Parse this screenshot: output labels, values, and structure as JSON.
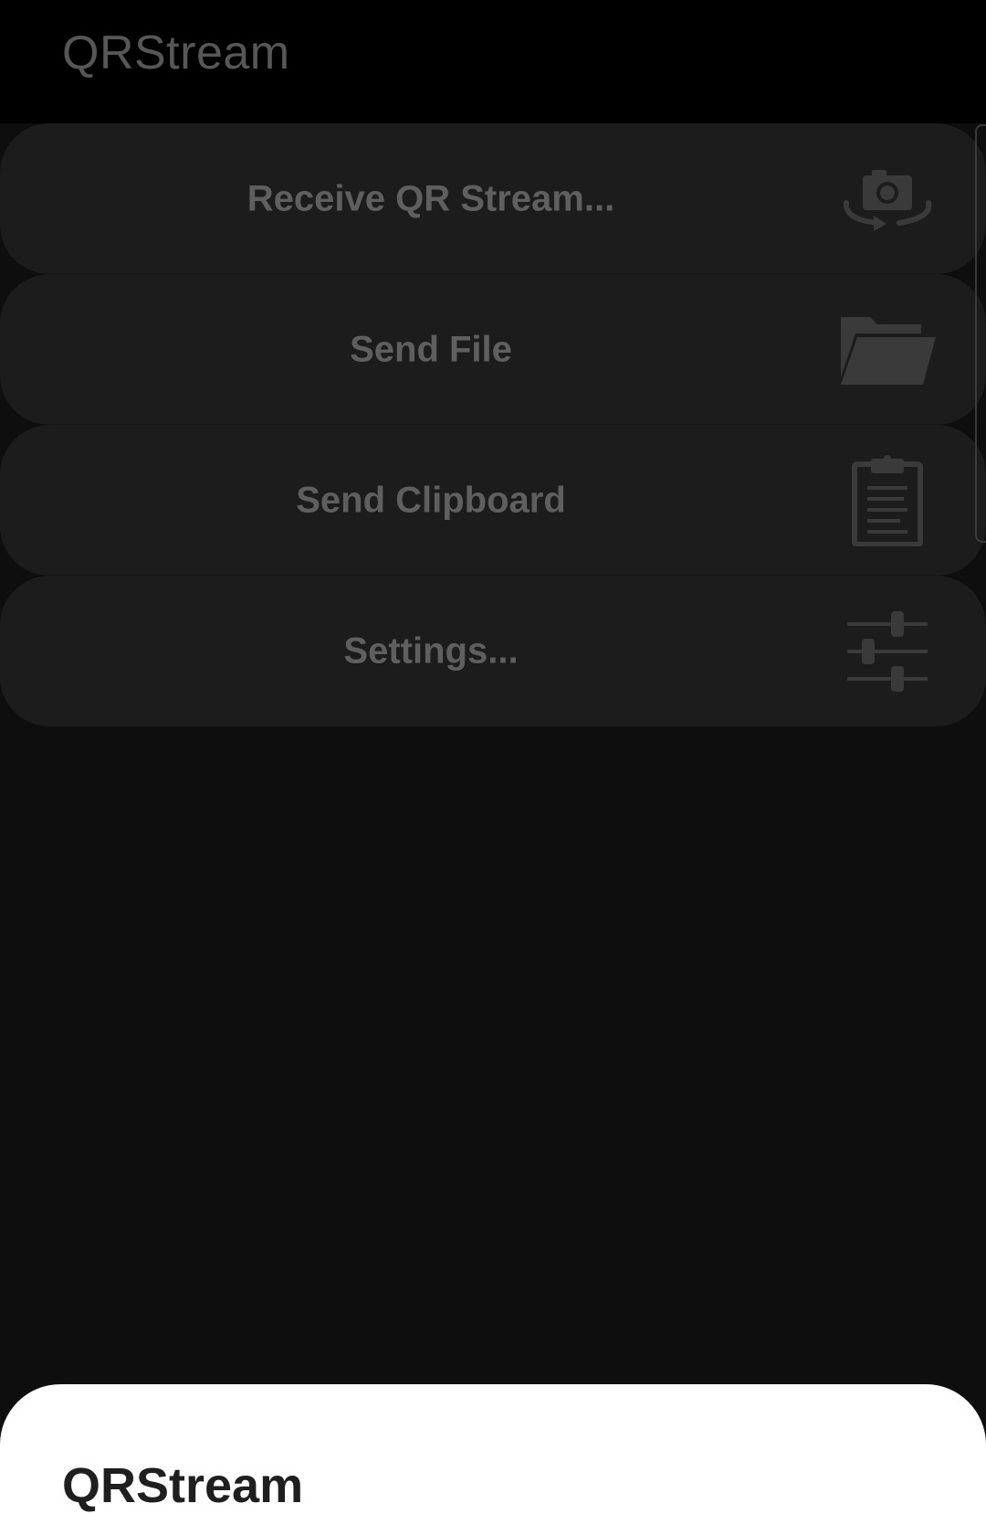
{
  "app_bar": {
    "title": "QRStream"
  },
  "menu": {
    "items": [
      {
        "label": "Receive QR Stream...",
        "icon": "camera-rotate-icon"
      },
      {
        "label": "Send File",
        "icon": "folder-icon"
      },
      {
        "label": "Send Clipboard",
        "icon": "clipboard-icon"
      },
      {
        "label": "Settings...",
        "icon": "sliders-icon"
      }
    ]
  },
  "sheet": {
    "title": "QRStream"
  },
  "colors": {
    "app_bar_bg": "#000000",
    "background": "#0e0e0e",
    "menu_item_bg": "#1c1c1c",
    "menu_text": "#5f5f5f",
    "icon": "#3a3a3a",
    "sheet_bg": "#ffffff",
    "sheet_text": "#1f1f1f"
  }
}
